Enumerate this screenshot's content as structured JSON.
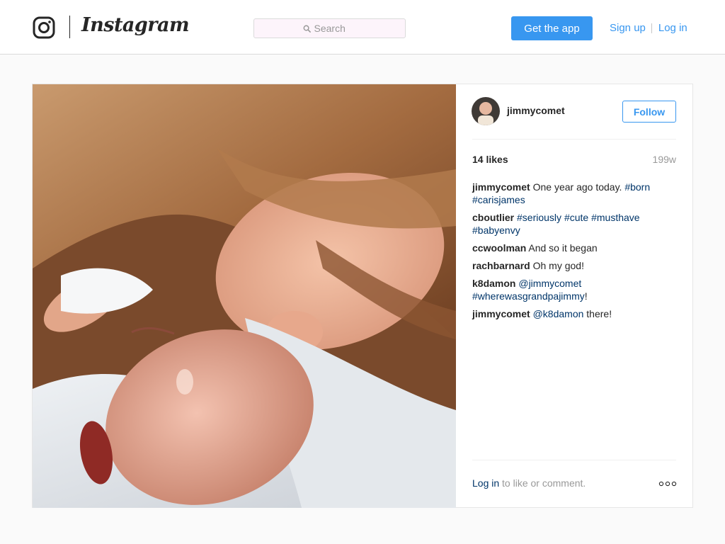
{
  "header": {
    "glyph_icon": "instagram-camera-icon",
    "wordmark": "Instagram",
    "search": {
      "placeholder": "Search",
      "icon": "search-icon"
    },
    "get_app_label": "Get the app",
    "signup_label": "Sign up",
    "login_label": "Log in"
  },
  "post": {
    "image_alt": "newborn-with-sister-photo",
    "owner": {
      "username": "jimmycomet",
      "avatar_icon": "avatar-image"
    },
    "follow_label": "Follow",
    "likes": "14 likes",
    "age": "199w",
    "comments": [
      {
        "user": "jimmycomet",
        "parts": [
          {
            "text": " One year ago today. "
          },
          {
            "tag": "#born"
          },
          {
            "text": " "
          },
          {
            "tag": "#carisjames"
          }
        ]
      },
      {
        "user": "cboutlier",
        "parts": [
          {
            "text": " "
          },
          {
            "tag": "#seriously"
          },
          {
            "text": " "
          },
          {
            "tag": "#cute"
          },
          {
            "text": " "
          },
          {
            "tag": "#musthave"
          },
          {
            "text": " "
          },
          {
            "tag": "#babyenvy"
          }
        ]
      },
      {
        "user": "ccwoolman",
        "parts": [
          {
            "text": " And so it began"
          }
        ]
      },
      {
        "user": "rachbarnard",
        "parts": [
          {
            "text": " Oh my god!"
          }
        ]
      },
      {
        "user": "k8damon",
        "parts": [
          {
            "text": " "
          },
          {
            "tag": "@jimmycomet"
          },
          {
            "text": " "
          },
          {
            "tag": "#wherewasgrandpajimmy"
          },
          {
            "text": "!"
          }
        ]
      },
      {
        "user": "jimmycomet",
        "parts": [
          {
            "text": " "
          },
          {
            "tag": "@k8damon"
          },
          {
            "text": " there!"
          }
        ]
      }
    ],
    "footer": {
      "login_link": "Log in",
      "suffix": " to like or comment.",
      "more_icon": "more-options-icon"
    }
  },
  "colors": {
    "accent": "#3897f0",
    "link": "#003569",
    "muted": "#999999",
    "text": "#262626"
  }
}
